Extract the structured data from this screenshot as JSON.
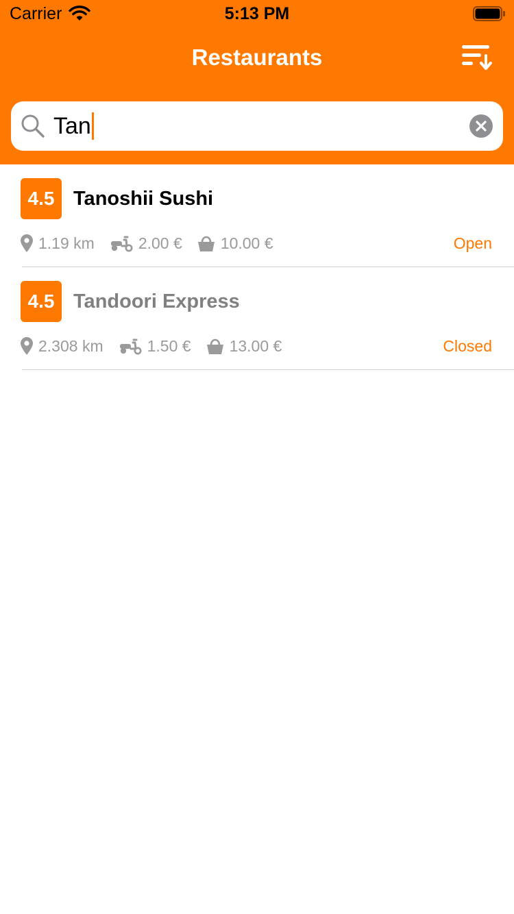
{
  "status_bar": {
    "carrier": "Carrier",
    "time": "5:13 PM"
  },
  "header": {
    "title": "Restaurants",
    "sort_icon": "sort-icon",
    "background_color": "#FF7800"
  },
  "search": {
    "value": "Tan",
    "search_icon": "search-icon",
    "clear_icon": "clear-icon"
  },
  "restaurants": [
    {
      "rating": "4.5",
      "name": "Tanoshii Sushi",
      "distance": "1.19 km",
      "delivery_fee": "2.00 €",
      "min_order": "10.00 €",
      "status": "Open"
    },
    {
      "rating": "4.5",
      "name": "Tandoori Express",
      "distance": "2.308 km",
      "delivery_fee": "1.50 €",
      "min_order": "13.00 €",
      "status": "Closed"
    }
  ],
  "colors": {
    "accent": "#FF7800",
    "muted_text": "#9a9a9a",
    "closed_name": "#808080"
  }
}
